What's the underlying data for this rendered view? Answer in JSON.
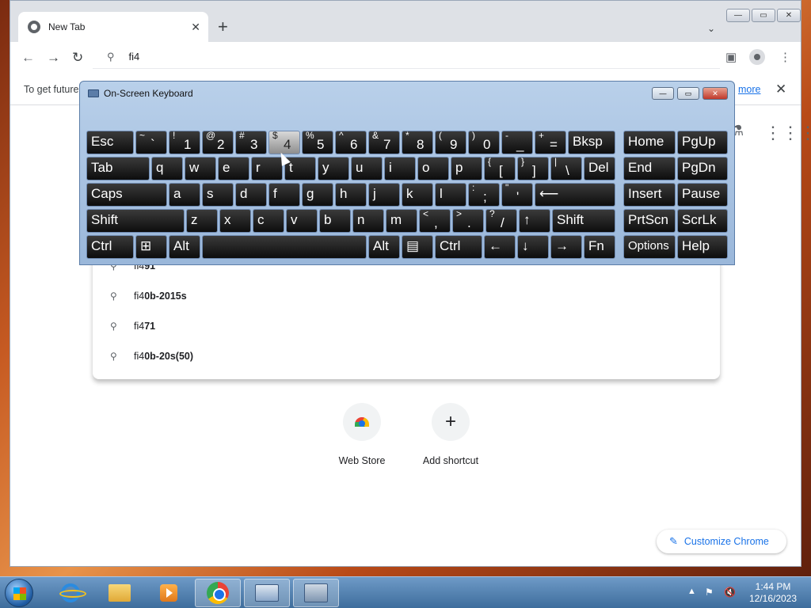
{
  "browser": {
    "tab_title": "New Tab",
    "tab_close": "✕",
    "new_tab": "+",
    "tab_search": "⌄",
    "window_buttons": [
      "—",
      "▭",
      "✕"
    ]
  },
  "toolbar": {
    "back": "←",
    "forward": "→",
    "reload": "↻",
    "omnibox_value": "fi4",
    "search_icon": "🔍",
    "side_panel": "▣",
    "menu": "⋮"
  },
  "infobar": {
    "message": "To get future",
    "link": "more",
    "close": "✕"
  },
  "suggestions": [
    {
      "prefix": "fi4",
      "rest": "91"
    },
    {
      "prefix": "fi4",
      "rest": "0b-2015s"
    },
    {
      "prefix": "fi4",
      "rest": "71"
    },
    {
      "prefix": "fi4",
      "rest": "0b-20s(50)"
    }
  ],
  "shortcuts": [
    {
      "label": "Web Store",
      "icon": "webstore-icon"
    },
    {
      "label": "Add shortcut",
      "icon": "plus-icon",
      "glyph": "+"
    }
  ],
  "customize": {
    "label": "Customize Chrome",
    "icon": "✎"
  },
  "osk": {
    "title": "On-Screen Keyboard",
    "window_buttons": [
      "—",
      "▭",
      "✕"
    ],
    "rows": [
      [
        {
          "t": "Esc",
          "w": 60
        },
        {
          "s": "~",
          "m": "`",
          "w": 40
        },
        {
          "s": "!",
          "m": "1",
          "w": 40
        },
        {
          "s": "@",
          "m": "2",
          "w": 40
        },
        {
          "s": "#",
          "m": "3",
          "w": 40
        },
        {
          "s": "$",
          "m": "4",
          "w": 40,
          "hl": true
        },
        {
          "s": "%",
          "m": "5",
          "w": 40
        },
        {
          "s": "^",
          "m": "6",
          "w": 40
        },
        {
          "s": "&",
          "m": "7",
          "w": 40
        },
        {
          "s": "*",
          "m": "8",
          "w": 40
        },
        {
          "s": "(",
          "m": "9",
          "w": 40
        },
        {
          "s": ")",
          "m": "0",
          "w": 40
        },
        {
          "s": "-",
          "m": "_",
          "w": 40
        },
        {
          "s": "+",
          "m": "=",
          "w": 40
        },
        {
          "t": "Bksp",
          "w": 60
        },
        {
          "t": "Home",
          "w": 66,
          "gap": 8
        },
        {
          "t": "PgUp",
          "w": 64
        }
      ],
      [
        {
          "t": "Tab",
          "w": 80
        },
        {
          "t": "q",
          "w": 40
        },
        {
          "t": "w",
          "w": 40
        },
        {
          "t": "e",
          "w": 40
        },
        {
          "t": "r",
          "w": 40
        },
        {
          "t": "t",
          "w": 40
        },
        {
          "t": "y",
          "w": 40
        },
        {
          "t": "u",
          "w": 40
        },
        {
          "t": "i",
          "w": 40
        },
        {
          "t": "o",
          "w": 40
        },
        {
          "t": "p",
          "w": 40
        },
        {
          "s": "{",
          "m": "[",
          "w": 40
        },
        {
          "s": "}",
          "m": "]",
          "w": 40
        },
        {
          "s": "|",
          "m": "\\",
          "w": 40
        },
        {
          "t": "Del",
          "w": 40
        },
        {
          "t": "End",
          "w": 66,
          "gap": 8
        },
        {
          "t": "PgDn",
          "w": 64
        }
      ],
      [
        {
          "t": "Caps",
          "w": 102
        },
        {
          "t": "a",
          "w": 40
        },
        {
          "t": "s",
          "w": 40
        },
        {
          "t": "d",
          "w": 40
        },
        {
          "t": "f",
          "w": 40
        },
        {
          "t": "g",
          "w": 40
        },
        {
          "t": "h",
          "w": 40
        },
        {
          "t": "j",
          "w": 40
        },
        {
          "t": "k",
          "w": 40
        },
        {
          "t": "l",
          "w": 40
        },
        {
          "s": ":",
          "m": ";",
          "w": 40
        },
        {
          "s": "\"",
          "m": "'",
          "w": 40
        },
        {
          "t": "⟵",
          "w": 102
        },
        {
          "t": "Insert",
          "w": 66,
          "gap": 8
        },
        {
          "t": "Pause",
          "w": 64
        }
      ],
      [
        {
          "t": "Shift",
          "w": 124
        },
        {
          "t": "z",
          "w": 40
        },
        {
          "t": "x",
          "w": 40
        },
        {
          "t": "c",
          "w": 40
        },
        {
          "t": "v",
          "w": 40
        },
        {
          "t": "b",
          "w": 40
        },
        {
          "t": "n",
          "w": 40
        },
        {
          "t": "m",
          "w": 40
        },
        {
          "s": "<",
          "m": ",",
          "w": 40
        },
        {
          "s": ">",
          "m": ".",
          "w": 40
        },
        {
          "s": "?",
          "m": "/",
          "w": 40
        },
        {
          "t": "↑",
          "w": 40
        },
        {
          "t": "Shift",
          "w": 80
        },
        {
          "t": "PrtScn",
          "w": 66,
          "gap": 8
        },
        {
          "t": "ScrLk",
          "w": 64
        }
      ],
      [
        {
          "t": "Ctrl",
          "w": 60
        },
        {
          "t": "⊞",
          "w": 40
        },
        {
          "t": "Alt",
          "w": 40
        },
        {
          "t": "",
          "w": 208
        },
        {
          "t": "Alt",
          "w": 40
        },
        {
          "t": "▤",
          "w": 40
        },
        {
          "t": "Ctrl",
          "w": 60
        },
        {
          "t": "←",
          "w": 40
        },
        {
          "t": "↓",
          "w": 40
        },
        {
          "t": "→",
          "w": 40
        },
        {
          "t": "Fn",
          "w": 40
        },
        {
          "t": "Options",
          "w": 66,
          "gap": 8,
          "small": true
        },
        {
          "t": "Help",
          "w": 64
        }
      ]
    ]
  },
  "taskbar": {
    "apps": [
      "internet-explorer-icon",
      "file-explorer-icon",
      "media-player-icon",
      "chrome-icon",
      "on-screen-keyboard-icon",
      "remote-app-icon"
    ],
    "time": "1:44 PM",
    "date": "12/16/2023",
    "tray_arrow": "▲"
  }
}
